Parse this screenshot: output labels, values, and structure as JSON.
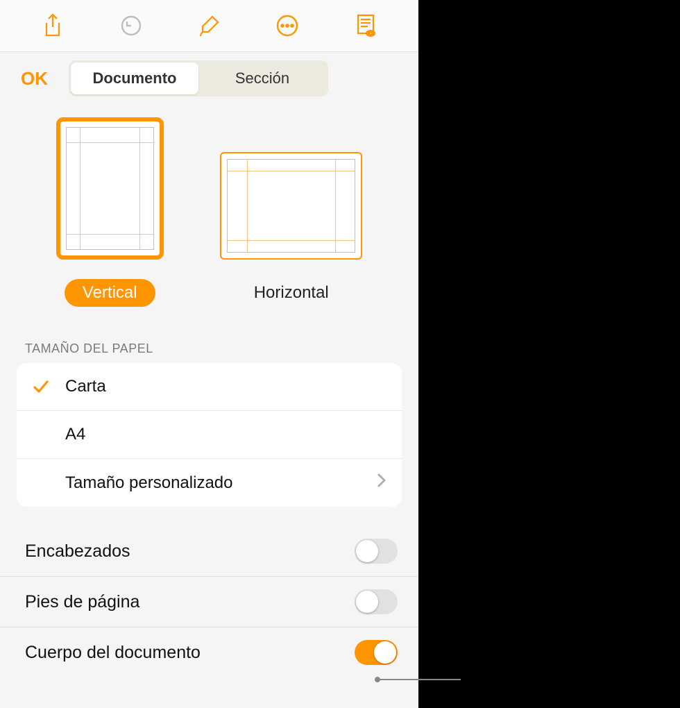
{
  "colors": {
    "accent": "#ff9500"
  },
  "toolbar": {
    "share_icon": "share-icon",
    "undo_icon": "undo-icon",
    "format_icon": "format-brush-icon",
    "more_icon": "more-icon",
    "view_icon": "view-options-icon"
  },
  "header": {
    "ok_label": "OK",
    "tabs": [
      {
        "label": "Documento",
        "active": true
      },
      {
        "label": "Sección",
        "active": false
      }
    ]
  },
  "orientation": {
    "options": [
      {
        "label": "Vertical",
        "active": true
      },
      {
        "label": "Horizontal",
        "active": false
      }
    ]
  },
  "paper_size": {
    "header": "TAMAÑO DEL PAPEL",
    "options": [
      {
        "label": "Carta",
        "selected": true,
        "disclosure": false
      },
      {
        "label": "A4",
        "selected": false,
        "disclosure": false
      },
      {
        "label": "Tamaño personalizado",
        "selected": false,
        "disclosure": true
      }
    ]
  },
  "toggles": [
    {
      "label": "Encabezados",
      "on": false
    },
    {
      "label": "Pies de página",
      "on": false
    },
    {
      "label": "Cuerpo del documento",
      "on": true
    }
  ]
}
